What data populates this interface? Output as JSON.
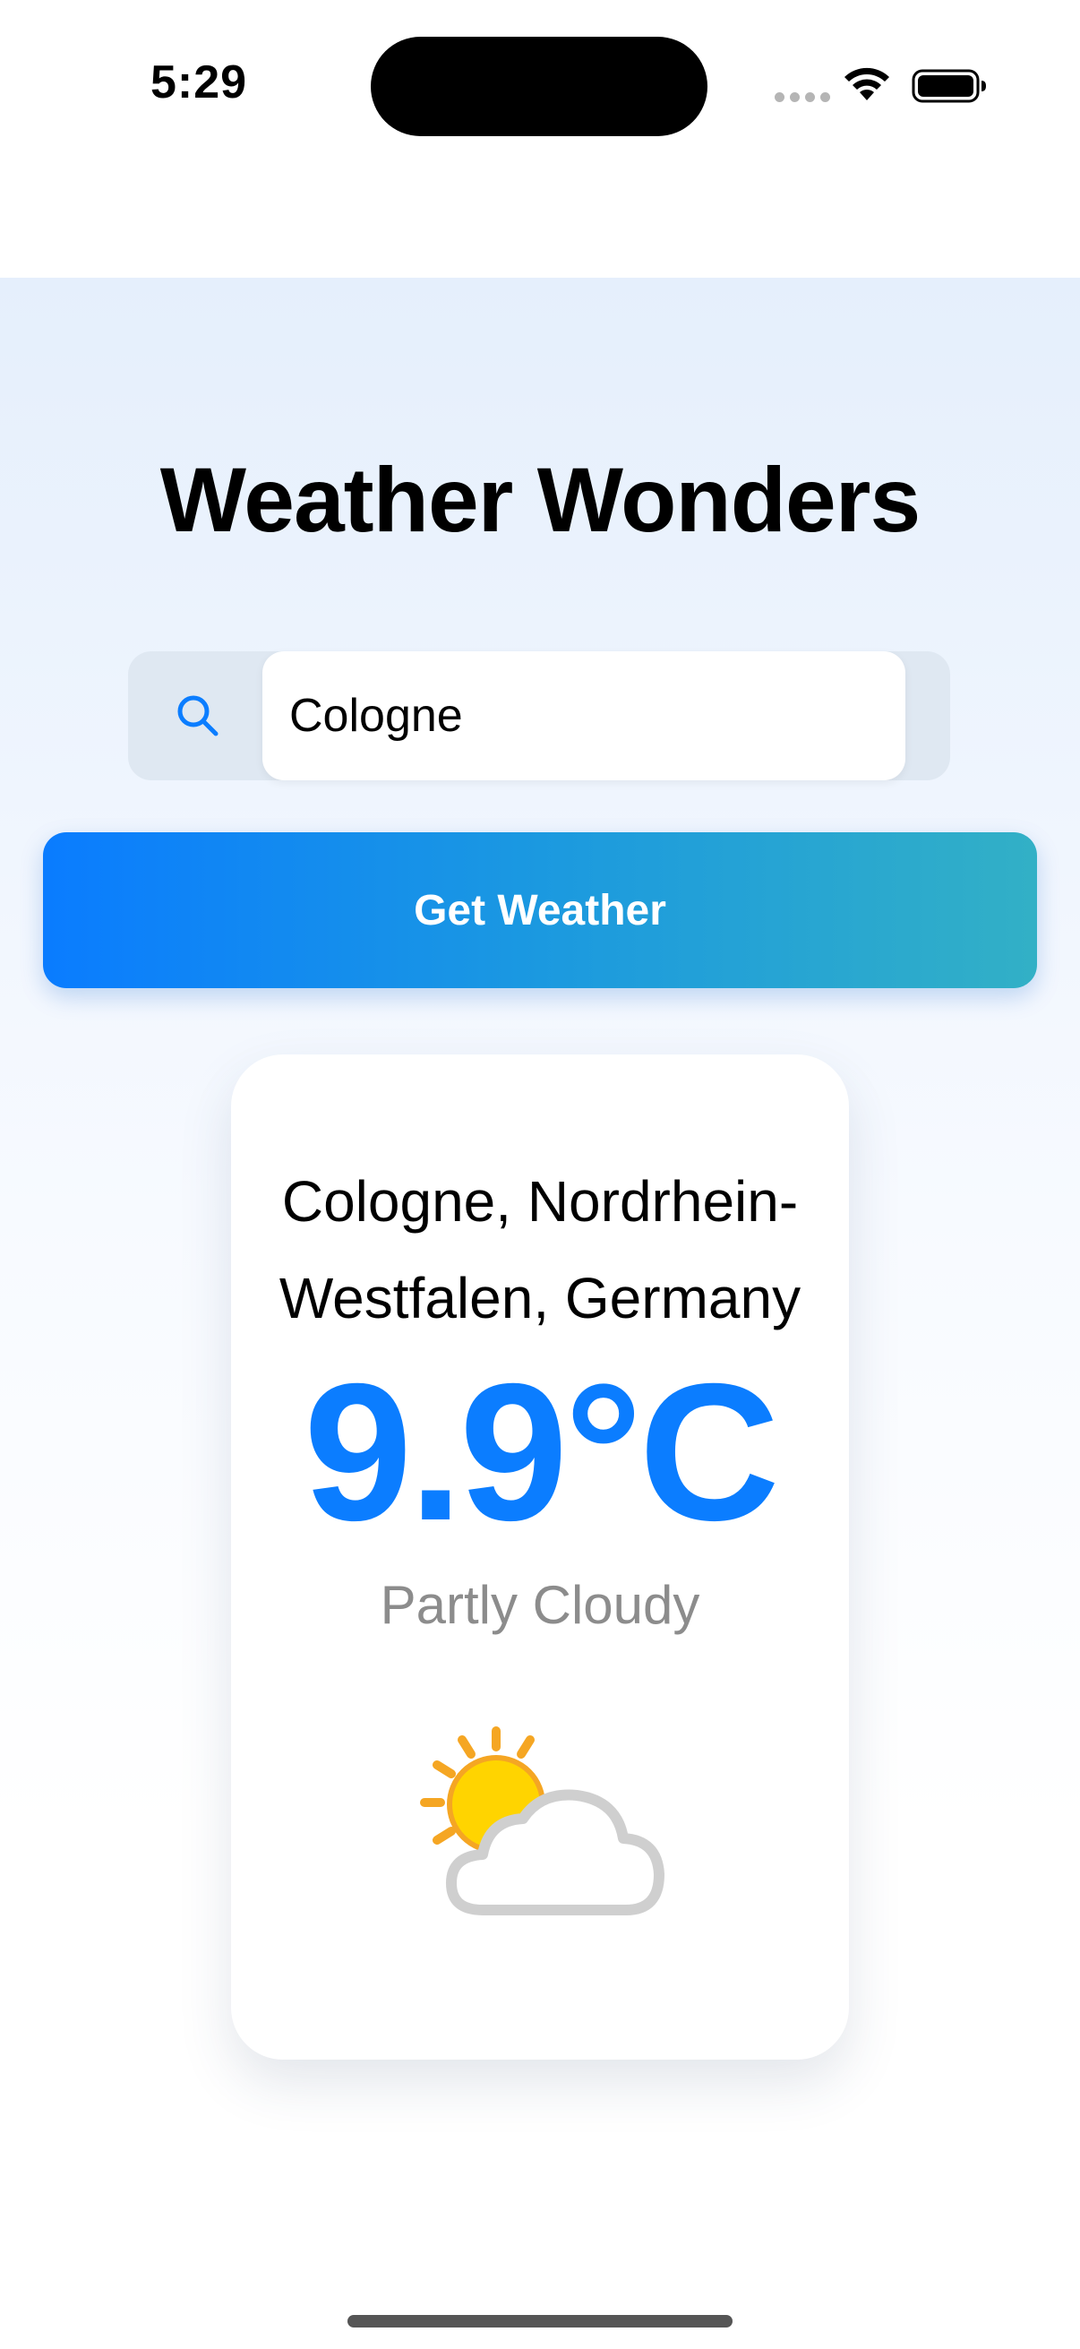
{
  "status_bar": {
    "time": "5:29"
  },
  "app": {
    "title": "Weather Wonders"
  },
  "search": {
    "value": "Cologne",
    "icon": "search-icon"
  },
  "button": {
    "label": "Get Weather"
  },
  "weather": {
    "location": "Cologne, Nordrhein-Westfalen, Germany",
    "temperature": "9.9°C",
    "condition": "Partly Cloudy",
    "icon": "partly-cloudy-icon"
  },
  "colors": {
    "accent": "#0B7DFF",
    "button_gradient_start": "#0A7CFF",
    "button_gradient_end": "#32B0C6",
    "condition_text": "#8C8C8C"
  }
}
